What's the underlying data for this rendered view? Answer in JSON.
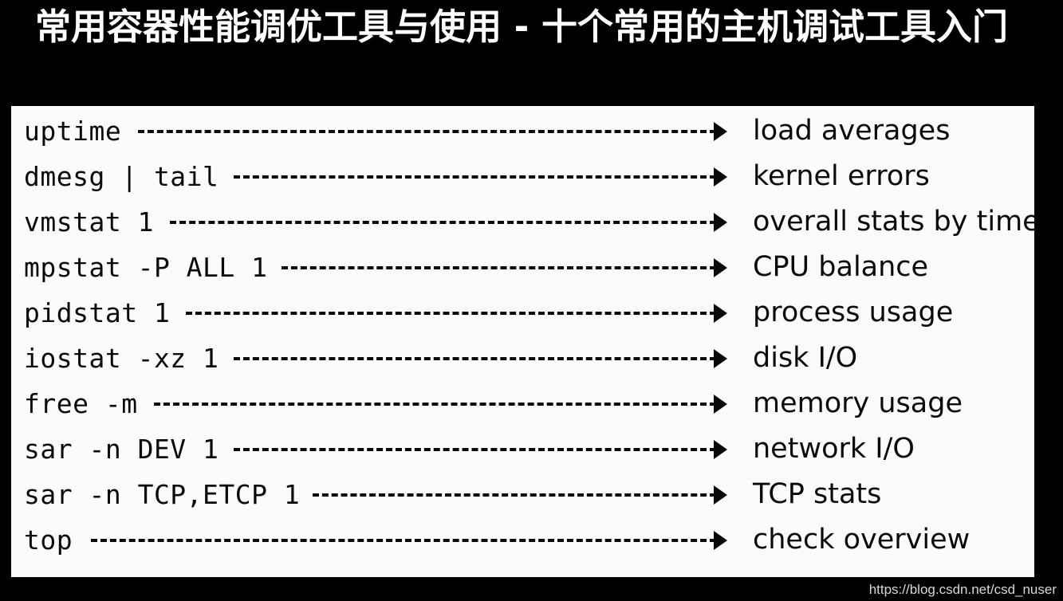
{
  "header": {
    "title": "常用容器性能调优工具与使用 - 十个常用的主机调试工具入门"
  },
  "panel": {
    "arrow_icon": "dashed-arrow-icon",
    "rows": [
      {
        "command": "uptime",
        "description": "load averages"
      },
      {
        "command": "dmesg | tail",
        "description": "kernel errors"
      },
      {
        "command": "vmstat 1",
        "description": "overall stats by time"
      },
      {
        "command": "mpstat -P ALL 1",
        "description": "CPU balance"
      },
      {
        "command": "pidstat 1",
        "description": "process usage"
      },
      {
        "command": "iostat -xz 1",
        "description": "disk I/O"
      },
      {
        "command": "free -m",
        "description": "memory usage"
      },
      {
        "command": "sar -n DEV 1",
        "description": "network I/O"
      },
      {
        "command": "sar -n TCP,ETCP 1",
        "description": "TCP stats"
      },
      {
        "command": "top",
        "description": "check overview"
      }
    ]
  },
  "watermark": {
    "text": "https://blog.csdn.net/csd_nuser"
  },
  "colors": {
    "background": "#000000",
    "panel": "#fbfbfa",
    "title_text": "#ffffff",
    "body_text": "#0a0a0a",
    "watermark_text": "#d8d8d8"
  }
}
